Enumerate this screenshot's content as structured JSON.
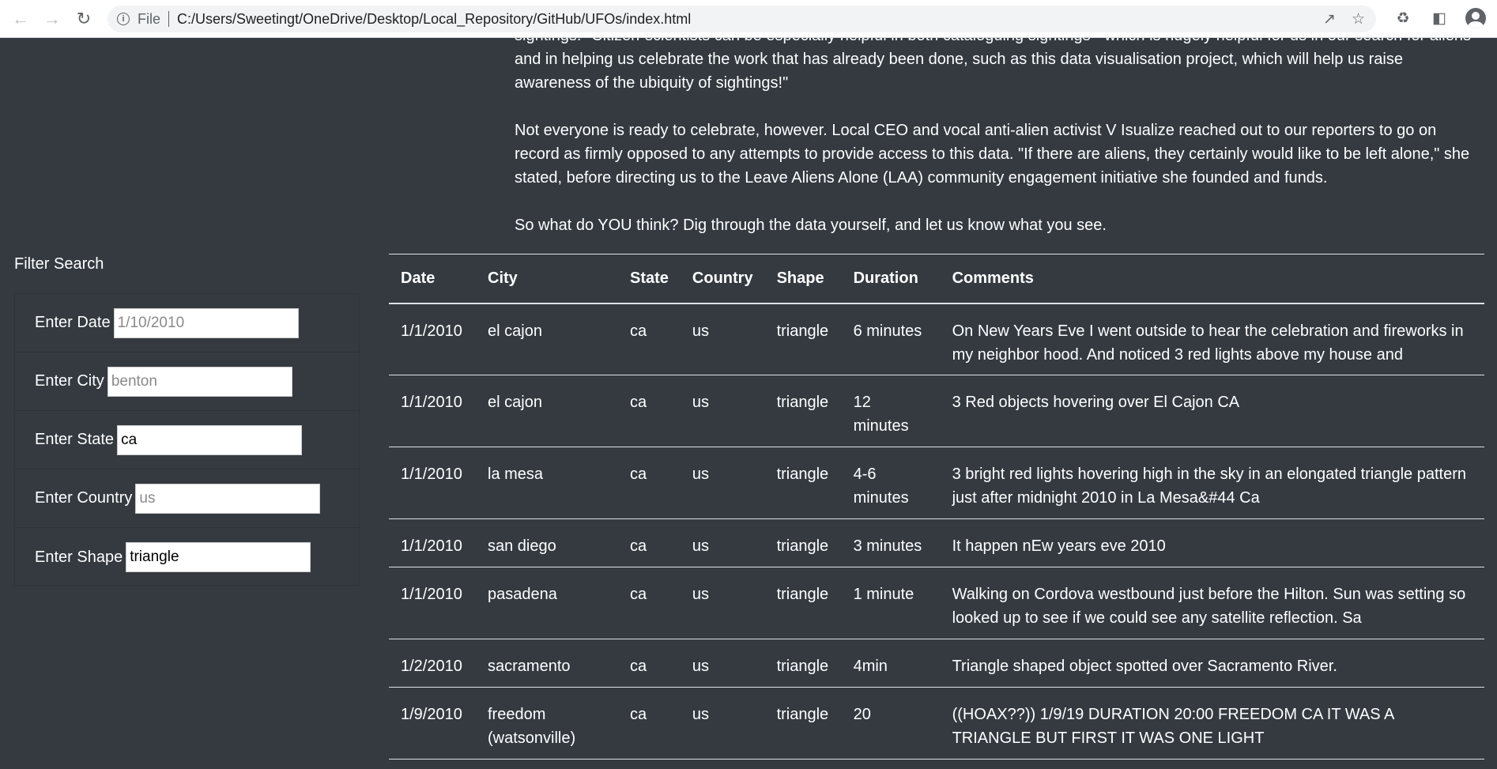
{
  "browser": {
    "scheme_label": "File",
    "url": "C:/Users/Sweetingt/OneDrive/Desktop/Local_Repository/GitHub/UFOs/index.html"
  },
  "article": {
    "para1": "sightings. \"Citizen-scientists can be especially helpful in both cataloguing sightings - which is hugely helpful for us in our search for aliens - and in helping us celebrate the work that has already been done, such as this data visualisation project, which will help us raise awareness of the ubiquity of sightings!\"",
    "para2": "Not everyone is ready to celebrate, however. Local CEO and vocal anti-alien activist V Isualize reached out to our reporters to go on record as firmly opposed to any attempts to provide access to this data. \"If there are aliens, they certainly would like to be left alone,\" she stated, before directing us to the Leave Aliens Alone (LAA) community engagement initiative she founded and funds.",
    "para3": "So what do YOU think? Dig through the data yourself, and let us know what you see."
  },
  "filters": {
    "title": "Filter Search",
    "date": {
      "label": "Enter Date",
      "value": "",
      "placeholder": "1/10/2010"
    },
    "city": {
      "label": "Enter City",
      "value": "",
      "placeholder": "benton"
    },
    "state": {
      "label": "Enter State",
      "value": "ca",
      "placeholder": ""
    },
    "country": {
      "label": "Enter Country",
      "value": "",
      "placeholder": "us"
    },
    "shape": {
      "label": "Enter Shape",
      "value": "triangle",
      "placeholder": ""
    }
  },
  "table": {
    "headers": [
      "Date",
      "City",
      "State",
      "Country",
      "Shape",
      "Duration",
      "Comments"
    ],
    "rows": [
      [
        "1/1/2010",
        "el cajon",
        "ca",
        "us",
        "triangle",
        "6 minutes",
        "On New Years Eve I went outside to hear the celebration and fireworks in my neighbor hood. And noticed 3 red lights above my house and"
      ],
      [
        "1/1/2010",
        "el cajon",
        "ca",
        "us",
        "triangle",
        "12 minutes",
        "3 Red objects hovering over El Cajon CA"
      ],
      [
        "1/1/2010",
        "la mesa",
        "ca",
        "us",
        "triangle",
        "4-6 minutes",
        "3 bright red lights hovering high in the sky in an elongated triangle pattern just after midnight 2010 in La Mesa&#44 Ca"
      ],
      [
        "1/1/2010",
        "san diego",
        "ca",
        "us",
        "triangle",
        "3 minutes",
        "It happen nEw years eve 2010"
      ],
      [
        "1/1/2010",
        "pasadena",
        "ca",
        "us",
        "triangle",
        "1 minute",
        "Walking on Cordova westbound just before the Hilton. Sun was setting so looked up to see if we could see any satellite reflection. Sa"
      ],
      [
        "1/2/2010",
        "sacramento",
        "ca",
        "us",
        "triangle",
        "4min",
        "Triangle shaped object spotted over Sacramento River."
      ],
      [
        "1/9/2010",
        "freedom (watsonville)",
        "ca",
        "us",
        "triangle",
        "20",
        "((HOAX??)) 1/9/19 DURATION 20:00 FREEDOM CA IT WAS A TRIANGLE BUT FIRST IT WAS ONE LIGHT"
      ]
    ]
  }
}
